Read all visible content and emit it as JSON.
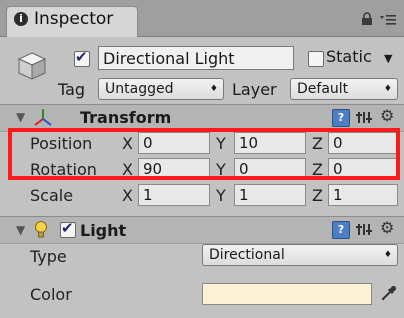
{
  "tab": {
    "label": "Inspector",
    "icon": "info-icon"
  },
  "object": {
    "name": "Directional Light",
    "active": true,
    "static_label": "Static",
    "static_checked": false,
    "tag_label": "Tag",
    "tag_value": "Untagged",
    "layer_label": "Layer",
    "layer_value": "Default"
  },
  "transform": {
    "title": "Transform",
    "rows": [
      {
        "label": "Position",
        "x": "0",
        "y": "10",
        "z": "0"
      },
      {
        "label": "Rotation",
        "x": "90",
        "y": "0",
        "z": "0"
      },
      {
        "label": "Scale",
        "x": "1",
        "y": "1",
        "z": "1"
      }
    ],
    "axes": {
      "x": "X",
      "y": "Y",
      "z": "Z"
    }
  },
  "light": {
    "title": "Light",
    "enabled": true,
    "type_label": "Type",
    "type_value": "Directional",
    "color_label": "Color",
    "color_value": "#fdf2d6"
  },
  "colors": {
    "highlight": "#ff1a1a",
    "help": "#4d7ec4"
  }
}
